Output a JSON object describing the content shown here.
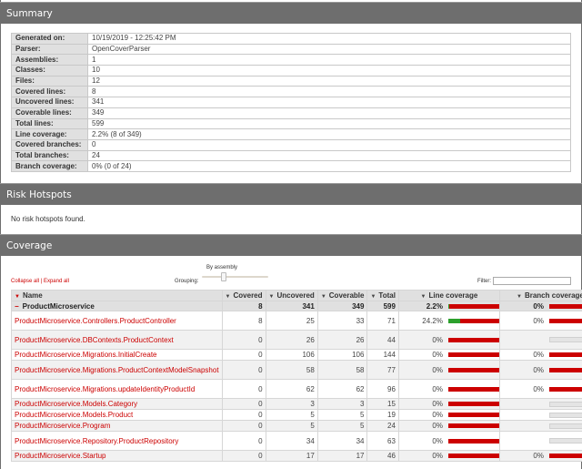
{
  "sections": {
    "summary": "Summary",
    "risk": "Risk Hotspots",
    "coverage": "Coverage"
  },
  "summary": [
    {
      "key": "Generated on:",
      "value": "10/19/2019 - 12:25:42 PM"
    },
    {
      "key": "Parser:",
      "value": "OpenCoverParser"
    },
    {
      "key": "Assemblies:",
      "value": "1"
    },
    {
      "key": "Classes:",
      "value": "10"
    },
    {
      "key": "Files:",
      "value": "12"
    },
    {
      "key": "Covered lines:",
      "value": "8"
    },
    {
      "key": "Uncovered lines:",
      "value": "341"
    },
    {
      "key": "Coverable lines:",
      "value": "349"
    },
    {
      "key": "Total lines:",
      "value": "599"
    },
    {
      "key": "Line coverage:",
      "value": "2.2% (8 of 349)"
    },
    {
      "key": "Covered branches:",
      "value": "0"
    },
    {
      "key": "Total branches:",
      "value": "24"
    },
    {
      "key": "Branch coverage:",
      "value": "0% (0 of 24)"
    }
  ],
  "risk": {
    "message": "No risk hotspots found."
  },
  "controls": {
    "collapse_all": "Collapse all",
    "separator": "|",
    "expand_all": "Expand all",
    "grouping_label": "Grouping:",
    "grouping_value": "By assembly",
    "filter_label": "Filter:",
    "filter_value": ""
  },
  "table": {
    "headers": {
      "name": "Name",
      "covered": "Covered",
      "uncovered": "Uncovered",
      "coverable": "Coverable",
      "total": "Total",
      "line_coverage": "Line coverage",
      "branch_coverage": "Branch coverage"
    },
    "assembly": {
      "name": "ProductMicroservice",
      "covered": "8",
      "uncovered": "341",
      "coverable": "349",
      "total": "599",
      "line_pct": "2.2%",
      "line_fraction": 0.022,
      "branch_pct": "0%",
      "branch_fraction": 0.0
    },
    "rows": [
      {
        "name": "ProductMicroservice.Controllers.ProductController",
        "covered": "8",
        "uncovered": "25",
        "coverable": "33",
        "total": "71",
        "line_pct": "24.2%",
        "line_fraction": 0.242,
        "branch_pct": "0%",
        "branch_fraction": 0.0
      },
      {
        "name": "ProductMicroservice.DBContexts.ProductContext",
        "covered": "0",
        "uncovered": "26",
        "coverable": "26",
        "total": "44",
        "line_pct": "0%",
        "line_fraction": 0.0,
        "branch_pct": "",
        "branch_fraction": null
      },
      {
        "name": "ProductMicroservice.Migrations.InitialCreate",
        "covered": "0",
        "uncovered": "106",
        "coverable": "106",
        "total": "144",
        "line_pct": "0%",
        "line_fraction": 0.0,
        "branch_pct": "0%",
        "branch_fraction": 0.0
      },
      {
        "name": "ProductMicroservice.Migrations.ProductContextModelSnapshot",
        "covered": "0",
        "uncovered": "58",
        "coverable": "58",
        "total": "77",
        "line_pct": "0%",
        "line_fraction": 0.0,
        "branch_pct": "0%",
        "branch_fraction": 0.0
      },
      {
        "name": "ProductMicroservice.Migrations.updateIdentityProductId",
        "covered": "0",
        "uncovered": "62",
        "coverable": "62",
        "total": "96",
        "line_pct": "0%",
        "line_fraction": 0.0,
        "branch_pct": "0%",
        "branch_fraction": 0.0
      },
      {
        "name": "ProductMicroservice.Models.Category",
        "covered": "0",
        "uncovered": "3",
        "coverable": "3",
        "total": "15",
        "line_pct": "0%",
        "line_fraction": 0.0,
        "branch_pct": "",
        "branch_fraction": null
      },
      {
        "name": "ProductMicroservice.Models.Product",
        "covered": "0",
        "uncovered": "5",
        "coverable": "5",
        "total": "19",
        "line_pct": "0%",
        "line_fraction": 0.0,
        "branch_pct": "",
        "branch_fraction": null
      },
      {
        "name": "ProductMicroservice.Program",
        "covered": "0",
        "uncovered": "5",
        "coverable": "5",
        "total": "24",
        "line_pct": "0%",
        "line_fraction": 0.0,
        "branch_pct": "",
        "branch_fraction": null
      },
      {
        "name": "ProductMicroservice.Repository.ProductRepository",
        "covered": "0",
        "uncovered": "34",
        "coverable": "34",
        "total": "63",
        "line_pct": "0%",
        "line_fraction": 0.0,
        "branch_pct": "",
        "branch_fraction": null
      },
      {
        "name": "ProductMicroservice.Startup",
        "covered": "0",
        "uncovered": "17",
        "coverable": "17",
        "total": "46",
        "line_pct": "0%",
        "line_fraction": 0.0,
        "branch_pct": "0%",
        "branch_fraction": 0.0
      }
    ]
  }
}
